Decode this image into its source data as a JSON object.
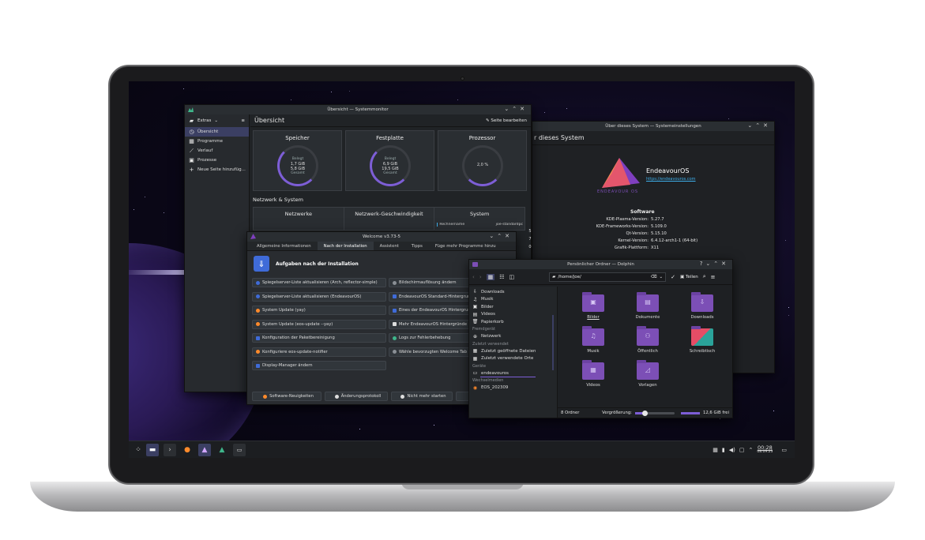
{
  "system_monitor": {
    "title": "Übersicht — Systemmonitor",
    "extras": "Extras",
    "sidebar": [
      {
        "label": "Übersicht",
        "icon": "clock-icon",
        "active": true
      },
      {
        "label": "Programme",
        "icon": "grid-icon"
      },
      {
        "label": "Verlauf",
        "icon": "chart-icon"
      },
      {
        "label": "Prozesse",
        "icon": "window-icon"
      },
      {
        "label": "Neue Seite hinzufüg...",
        "icon": "plus-icon"
      }
    ],
    "page_title": "Übersicht",
    "edit_page": "Seite bearbeiten",
    "cards": [
      {
        "title": "Speicher",
        "l1": "Belegt",
        "v1": "1,7 GiB",
        "v2": "5,8 GiB",
        "l2": "Gesamt"
      },
      {
        "title": "Festplatte",
        "l1": "Belegt",
        "v1": "6,9 GiB",
        "v2": "19,5 GiB",
        "l2": "Gesamt"
      },
      {
        "title": "Prozessor",
        "value": "2,0 %"
      }
    ],
    "section2": "Netzwerk & System",
    "cards2": [
      "Netzwerke",
      "Netzwerk-Geschwindigkeit",
      "System"
    ],
    "system_rows": [
      {
        "k": "Rechnername",
        "v": "joe-standardpc"
      }
    ],
    "edge_digits": [
      "5",
      "7",
      "0"
    ]
  },
  "welcome": {
    "title": "Welcome v3.73-5",
    "tabs": [
      "Allgemeine Informationen",
      "Nach der Installation",
      "Assistent",
      "Tipps",
      "Füge mehr Programme hinzu"
    ],
    "heading": "Aufgaben nach der Installation",
    "left_buttons": [
      "Spiegelserver-Liste aktualisieren (Arch, reflector-simple)",
      "Spiegelserver-Liste aktualisieren (EndeavourOS)",
      "System Update (yay)",
      "System Update (eos-update --yay)",
      "Konfiguration der Paketbereinigung",
      "Konfiguriere eos-update-notifier",
      "Display-Manager ändern"
    ],
    "right_buttons": [
      "Bildschirmauflösung ändern",
      "EndeavourOS Standard-Hintergrund",
      "Eines der EndeavourOS Hintergrund",
      "Mehr EndeavourOS Hintergründe",
      "Logs zur Fehlerbehebung",
      "Wähle bevorzugten Welcome Tab"
    ],
    "footer": [
      "Software-Neuigkeiten",
      "Änderungsprotokoll",
      "Nicht mehr starten"
    ]
  },
  "info_center": {
    "title": "Über dieses System — Systemeinstellungen",
    "page_title": "r dieses System",
    "distro": "EndeavourOS",
    "link": "https://endeavouros.com",
    "logo_text": "ENDEAVOUR OS",
    "software_heading": "Software",
    "rows": [
      {
        "k": "KDE-Plasma-Version:",
        "v": "5.27.7"
      },
      {
        "k": "KDE-Frameworks-Version:",
        "v": "5.109.0"
      },
      {
        "k": "Qt-Version:",
        "v": "5.15.10"
      },
      {
        "k": "Kernel-Version:",
        "v": "6.4.12-arch1-1 (64-bit)"
      },
      {
        "k": "Grafik-Plattform:",
        "v": "X11"
      }
    ]
  },
  "dolphin": {
    "title": "Persönlicher Ordner — Dolphin",
    "path": "/home/joe/",
    "share": "Teilen",
    "sidebar": [
      {
        "type": "item",
        "label": "Downloads",
        "icon": "download-icon"
      },
      {
        "type": "item",
        "label": "Musik",
        "icon": "music-icon"
      },
      {
        "type": "item",
        "label": "Bilder",
        "icon": "image-icon"
      },
      {
        "type": "item",
        "label": "Videos",
        "icon": "video-icon"
      },
      {
        "type": "item",
        "label": "Papierkorb",
        "icon": "trash-icon"
      },
      {
        "type": "section",
        "label": "Fremdgerät"
      },
      {
        "type": "item",
        "label": "Netzwerk",
        "icon": "network-icon"
      },
      {
        "type": "section",
        "label": "Zuletzt verwendet"
      },
      {
        "type": "item",
        "label": "Zuletzt geöffnete Dateien",
        "icon": "recent-files-icon"
      },
      {
        "type": "item",
        "label": "Zuletzt verwendete Orte",
        "icon": "recent-places-icon"
      },
      {
        "type": "section",
        "label": "Geräte"
      },
      {
        "type": "item",
        "label": "endeavouros",
        "icon": "drive-icon"
      },
      {
        "type": "section",
        "label": "Wechselmedien"
      },
      {
        "type": "item",
        "label": "EOS_202309",
        "icon": "disc-icon"
      }
    ],
    "folders": [
      {
        "label": "Bilder",
        "glyph": "▣"
      },
      {
        "label": "Dokumente",
        "glyph": "▤"
      },
      {
        "label": "Downloads",
        "glyph": "⇩"
      },
      {
        "label": "Musik",
        "glyph": "♫"
      },
      {
        "label": "Öffentlich",
        "glyph": "⚇"
      },
      {
        "label": "Schreibtisch",
        "glyph": ""
      },
      {
        "label": "Videos",
        "glyph": "▦"
      },
      {
        "label": "Vorlagen",
        "glyph": "◿"
      }
    ],
    "status_count": "8 Ordner",
    "zoom_label": "Vergrößerung:",
    "free": "12,6 GiB frei"
  },
  "taskbar": {
    "time": "00:28",
    "date": "08.09.23"
  },
  "colors": {
    "accent": "#7c4fb6",
    "selection": "#3b3f63",
    "progress": "#7d5ed6"
  }
}
